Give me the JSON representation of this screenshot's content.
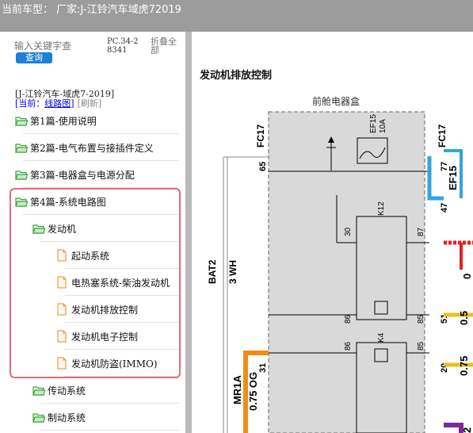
{
  "topbar": {
    "title": "当前车型： 厂家:J-江铃汽车域虎72019"
  },
  "sidebar": {
    "search_placeholder": "输入关键字查",
    "search_button": "查询",
    "doc_code": "PC.34-28341",
    "collapse_all": "折叠全部",
    "crumb_title": "[J-江铃汽车-域虎7-2019]",
    "crumb_current_label": "[当前：",
    "crumb_current": "线路图",
    "crumb_close": "]",
    "crumb_refresh": "[刷新]",
    "tree": [
      {
        "label": "第1篇-使用说明",
        "icon": "folder-open-icon"
      },
      {
        "label": "第2篇-电气布置与接插件定义",
        "icon": "folder-open-icon"
      },
      {
        "label": "第3篇-电器盒与电源分配",
        "icon": "folder-open-icon"
      },
      {
        "label": "第4篇-系统电路图",
        "icon": "folder-open-icon"
      },
      {
        "label": "发动机",
        "icon": "folder-open-icon"
      },
      {
        "label": "起动系统",
        "icon": "document-icon"
      },
      {
        "label": "电热塞系统-柴油发动机",
        "icon": "document-icon"
      },
      {
        "label": "发动机排放控制",
        "icon": "document-icon"
      },
      {
        "label": "发动机电子控制",
        "icon": "document-icon"
      },
      {
        "label": "发动机防盗(IMMO)",
        "icon": "document-icon"
      },
      {
        "label": "传动系统",
        "icon": "folder-open-icon"
      },
      {
        "label": "制动系统",
        "icon": "folder-open-icon"
      }
    ]
  },
  "diagram": {
    "title": "发动机排放控制",
    "fuse_box": "前舱电器盒",
    "fc17_left": "FC17",
    "fc17_right": "FC17",
    "fuse_name": "EF15",
    "fuse_rating": "10A",
    "ef15_label": "EF15",
    "bat2": "BAT2",
    "wire_3wh": "3 WH",
    "relay_k12": "K12",
    "relay_k4": "K4",
    "mr1a": "MR1A",
    "wire_075og": "0.75 OG",
    "pin_65": "65",
    "pin_77": "77",
    "pin_47": "47",
    "pin_30": "30",
    "pin_87": "87",
    "pin_86a": "86",
    "pin_85a": "85",
    "pin_51": "51",
    "pin_86b": "86",
    "pin_85b": "85",
    "pin_20": "20",
    "pin_31": "31",
    "wire_05": "0.5",
    "wire_075": "0.75",
    "wire_2": "2",
    "wire_0": "0"
  },
  "colors": {
    "topbar_bg": "#9c9c9c",
    "accent_blue": "#1e7fd8",
    "highlight": "#e36b7c",
    "folder_green": "#3aa63a",
    "doc_orange": "#e9a24a",
    "wire_orange": "#f08c1a",
    "wire_blue": "#33a4e0",
    "wire_red": "#e82020",
    "wire_yellow": "#e8c020",
    "wire_purple": "#7a2a9a"
  }
}
